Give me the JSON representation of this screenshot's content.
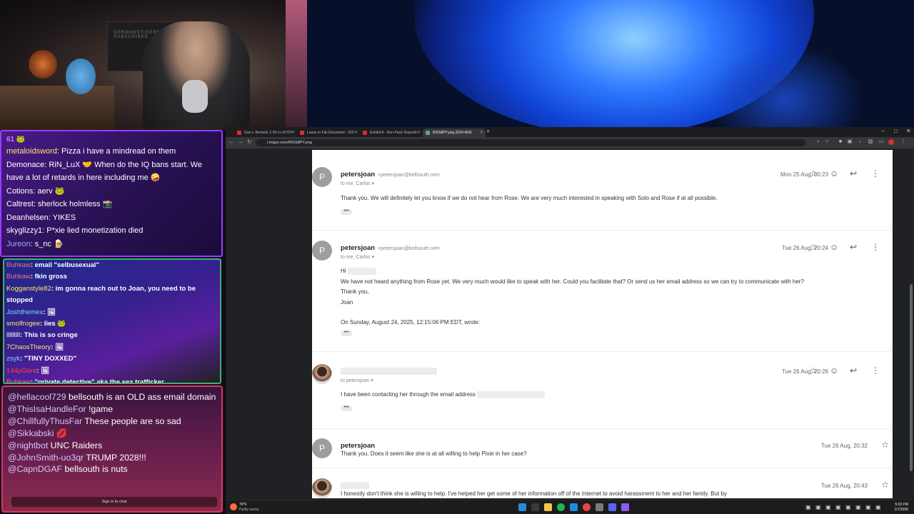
{
  "webcam": {
    "poster_text": "GERMANSTIGERMEN SUBSCRIBED"
  },
  "chat_top": {
    "viewer_count": "61",
    "messages": [
      {
        "user": "metaloidsword",
        "text": ": Pizza i have a mindread on them",
        "color": "#ffe36b"
      },
      {
        "user": "Demonace",
        "text": ": RiN_LuX 🤝 When do the IQ bans start. We",
        "color": "#ffffff"
      },
      {
        "user": "",
        "text": "have a lot of retards in here including me 🤪",
        "color": "#ffffff"
      },
      {
        "user": "Cotions",
        "text": ": aerv 🐸",
        "color": "#ffffff"
      },
      {
        "user": "Caltrest",
        "text": ": sherlock holmless 📸",
        "color": "#ffffff"
      },
      {
        "user": "Deanhelsen",
        "text": ": YIKES",
        "color": "#ffffff"
      },
      {
        "user": "skyglizzy1",
        "text": ": P*xie lied monetization died",
        "color": "#ffffff"
      },
      {
        "user": "Jureon",
        "text": ": s_nc 🍺",
        "color": "#9aa0ff"
      }
    ]
  },
  "chat_mid": {
    "messages": [
      {
        "user": "Buhkaw",
        "text": ": email \"selbusexual\"",
        "color": "#ff6b6b"
      },
      {
        "user": "Buhkaw",
        "text": ": fkin gross",
        "color": "#ff6b6b"
      },
      {
        "user": "Kogganstyle82",
        "text": ": im gonna reach out to Joan, you need to be",
        "color": "#ffe36b"
      },
      {
        "user": "",
        "text": "stopped",
        "color": "#ffe36b"
      },
      {
        "user": "Joshthemex",
        "text": ": 🖼",
        "color": "#7fd7ff"
      },
      {
        "user": "smolfrogee",
        "text": ": lies 🐸",
        "color": "#ffe36b"
      },
      {
        "user": "lllllllll",
        "text": ": This is so cringe",
        "color": "#ffffff"
      },
      {
        "user": "7ChaosTheory",
        "text": ": 🖼",
        "color": "#ffe36b"
      },
      {
        "user": "zsyk",
        "text": ": \"TINY DOXXED\"",
        "color": "#7fd7ff"
      },
      {
        "user": "144pGore",
        "text": ": 🖼",
        "color": "#ff4444"
      },
      {
        "user": "Buhkaw",
        "text": ": \"private detective\" aka the sex trafficker",
        "color": "#ff6b6b"
      }
    ]
  },
  "chat_bottom": {
    "messages": [
      {
        "user": "@hellacool729",
        "text": " bellsouth is an OLD ass email domain"
      },
      {
        "user": "@ThisIsaHandleFor",
        "text": " !game"
      },
      {
        "user": "@ChillfullyThusFar",
        "text": " These people are so sad"
      },
      {
        "user": "@Sikkabski",
        "text": " 💋"
      },
      {
        "user": "@nightbot",
        "text": " UNC Raiders"
      },
      {
        "user": "@JohnSmith-uo3qr",
        "text": " TRUMP 2028!!!"
      },
      {
        "user": "@CapnDGAF",
        "text": " bellsouth is nuts"
      }
    ],
    "sign_in_label": "Sign in to chat"
  },
  "browser": {
    "tabs": [
      {
        "label": "Doe v. Bennett, 1:25-cv-20757"
      },
      {
        "label": "Leave to File Document - #20"
      },
      {
        "label": "Exhibit A - Non-Party Depositi"
      },
      {
        "label": "RISS8PY.png (630×464)"
      }
    ],
    "url": "i.imgur.com/RISS8PY.png",
    "window_controls": [
      "–",
      "□",
      "✕"
    ]
  },
  "email": {
    "messages": [
      {
        "avatar": "P",
        "sender": "petersjoan",
        "address": "<petersjoan@bellsouth.net>",
        "to": "to me, Carlos ▾",
        "date": "Mon 25 Aug, 00:23",
        "body": [
          "Thank you.               We will definitely let you know if we do not hear from Rose. We are very much interested in speaking with Solo and Rose if at all possible."
        ]
      },
      {
        "avatar": "P",
        "sender": "petersjoan",
        "address": "<petersjoan@bellsouth.net>",
        "to": "to me, Carlos ▾",
        "date": "Tue 26 Aug, 20:24",
        "body": [
          "Hi",
          "",
          "We have not heard anything from Rose yet. We very much would like to speak with her. Could you facilitate that? Or send us her email address so we can try to communicate with her?",
          "Thank you,",
          "Joan",
          "",
          "On Sunday, August 24, 2025, 12:15:06 PM EDT,                                   wrote:"
        ]
      },
      {
        "avatar": "",
        "sender": "",
        "address": "",
        "to": "to petersjoan ▾",
        "date": "Tue 26 Aug, 20:26",
        "body": [
          "I have been contacting her through the email address"
        ]
      },
      {
        "avatar": "P",
        "sender": "petersjoan",
        "address": "",
        "to": "",
        "date": "Tue 26 Aug, 20:32",
        "body": [
          "Thank you. Does it seem like she is at all willing to help Pixie in her case?"
        ]
      },
      {
        "avatar": "",
        "sender": "",
        "address": "",
        "to": "",
        "date": "Tue 26 Aug, 20:43",
        "body": [
          "I honestly don't think she is willing to help. I've helped her get some of her information off of the Internet to avoid harassment to her and her family. But by"
        ]
      }
    ],
    "more_label": "•••"
  },
  "taskbar": {
    "temperature": "79°F",
    "weather": "Partly sunny",
    "time": "5:03 PM",
    "date": "1/7/2026"
  }
}
